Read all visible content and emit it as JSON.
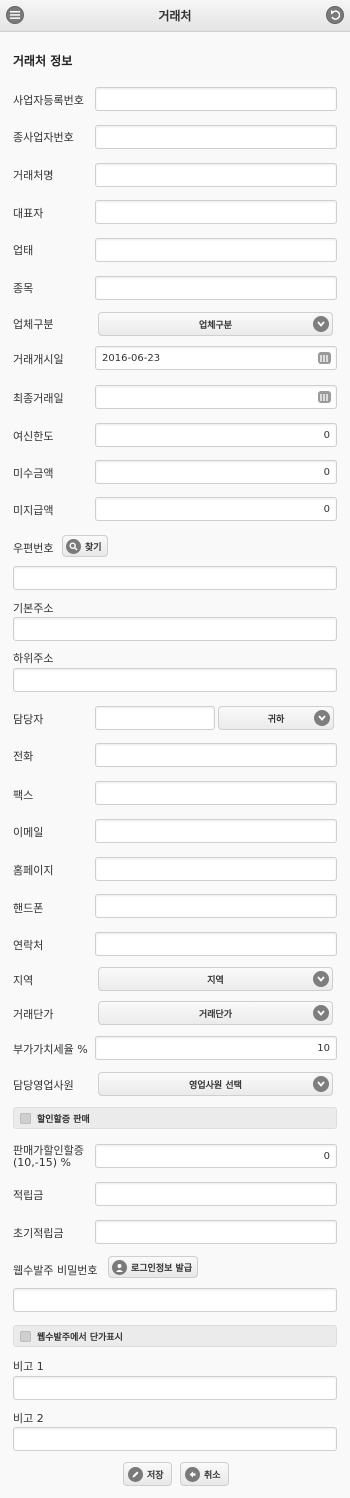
{
  "header": {
    "title": "거래처"
  },
  "section_title": "거래처 정보",
  "fields": {
    "biz_reg_no": {
      "label": "사업자등록번호",
      "value": ""
    },
    "sub_biz_no": {
      "label": "종사업자번호",
      "value": ""
    },
    "client_name": {
      "label": "거래처명",
      "value": ""
    },
    "ceo": {
      "label": "대표자",
      "value": ""
    },
    "biz_type": {
      "label": "업태",
      "value": ""
    },
    "biz_item": {
      "label": "종목",
      "value": ""
    },
    "company_class": {
      "label": "업체구분",
      "selected": "업체구분"
    },
    "start_date": {
      "label": "거래개시일",
      "value": "2016-06-23"
    },
    "last_date": {
      "label": "최종거래일",
      "value": ""
    },
    "credit_limit": {
      "label": "여신한도",
      "value": "0"
    },
    "receivable": {
      "label": "미수금액",
      "value": "0"
    },
    "payable": {
      "label": "미지급액",
      "value": "0"
    },
    "zipcode": {
      "label": "우편번호",
      "button": "찾기",
      "value": ""
    },
    "address": {
      "label": "기본주소",
      "value": ""
    },
    "address_detail": {
      "label": "하위주소",
      "value": ""
    },
    "manager": {
      "label": "담당자",
      "value": "",
      "title_selected": "귀하"
    },
    "phone": {
      "label": "전화",
      "value": ""
    },
    "fax": {
      "label": "팩스",
      "value": ""
    },
    "email": {
      "label": "이메일",
      "value": ""
    },
    "homepage": {
      "label": "홈페이지",
      "value": ""
    },
    "mobile": {
      "label": "핸드폰",
      "value": ""
    },
    "contact": {
      "label": "연락처",
      "value": ""
    },
    "region": {
      "label": "지역",
      "selected": "지역"
    },
    "price_level": {
      "label": "거래단가",
      "selected": "거래단가"
    },
    "vat_rate": {
      "label": "부가가치세율 %",
      "value": "10"
    },
    "sales_rep": {
      "label": "담당영업사원",
      "selected": "영업사원 선택"
    },
    "discount_check": {
      "label": "할인할증 판매"
    },
    "discount_rate": {
      "label_line1": "판매가할인할증",
      "label_line2": "(10,-15) %",
      "value": "0"
    },
    "points": {
      "label": "적립금",
      "value": ""
    },
    "initial_points": {
      "label": "초기적립금",
      "value": ""
    },
    "web_password": {
      "label": "웹수발주 비밀번호",
      "button": "로그인정보 발급",
      "value": ""
    },
    "web_price_check": {
      "label": "웹수발주에서 단가표시"
    },
    "note1": {
      "label": "비고 1",
      "value": ""
    },
    "note2": {
      "label": "비고 2",
      "value": ""
    }
  },
  "footer": {
    "save": "저장",
    "cancel": "취소"
  },
  "icons": {
    "menu": "menu-icon",
    "back": "back-icon",
    "chevron": "chevron-down-icon",
    "calendar": "calendar-icon",
    "search": "search-icon",
    "user": "user-icon",
    "save": "pencil-icon",
    "cancel": "cancel-arrow-icon"
  }
}
